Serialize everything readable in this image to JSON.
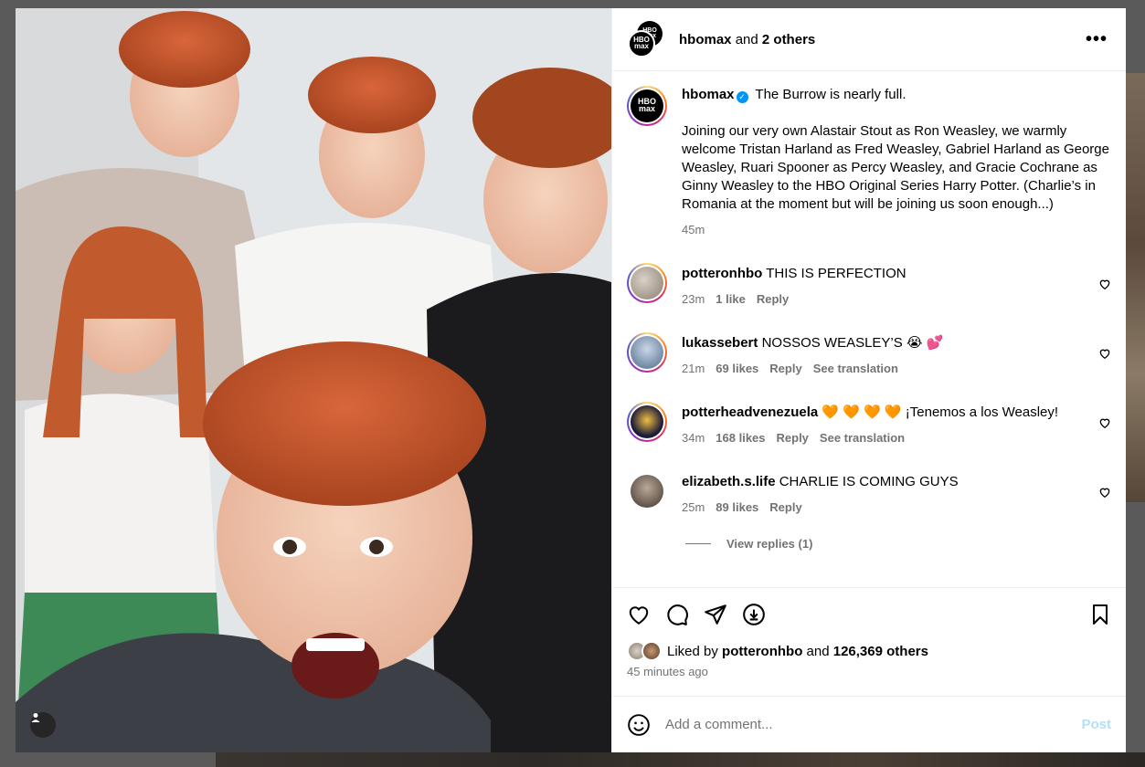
{
  "header": {
    "username": "hbomax",
    "and_text": "and",
    "others": "2 others",
    "more": "•••",
    "logo_top": "HBO",
    "logo_bottom": "max"
  },
  "caption": {
    "username": "hbomax",
    "first_line": "The Burrow is nearly full.",
    "body": "Joining our very own Alastair Stout as Ron Weasley, we warmly welcome Tristan Harland as Fred Weasley, Gabriel Harland as George Weasley, Ruari Spooner as Percy Weasley, and Gracie Cochrane as Ginny Weasley to the HBO Original Series Harry Potter. (Charlie’s in Romania at the moment but will be joining us soon enough...)",
    "time": "45m"
  },
  "comments": [
    {
      "username": "potteronhbo",
      "text": "THIS IS PERFECTION",
      "time": "23m",
      "likes": "1 like",
      "reply": "Reply",
      "translation": ""
    },
    {
      "username": "lukassebert",
      "text": "NOSSOS WEASLEY’S 😭 💕",
      "time": "21m",
      "likes": "69 likes",
      "reply": "Reply",
      "translation": "See translation"
    },
    {
      "username": "potterheadvenezuela",
      "text": "🧡 🧡 🧡 🧡 ¡Tenemos a los Weasley!",
      "time": "34m",
      "likes": "168 likes",
      "reply": "Reply",
      "translation": "See translation"
    },
    {
      "username": "elizabeth.s.life",
      "text": "CHARLIE IS COMING GUYS",
      "time": "25m",
      "likes": "89 likes",
      "reply": "Reply",
      "translation": ""
    }
  ],
  "view_replies": "View replies (1)",
  "likes": {
    "prefix": "Liked by",
    "user": "potteronhbo",
    "and": "and",
    "others": "126,369 others"
  },
  "posted": "45 minutes ago",
  "add_comment": {
    "placeholder": "Add a comment...",
    "post": "Post"
  },
  "colors": {
    "accent": "#0095f6",
    "post_disabled": "#b2dffc",
    "muted": "#737373"
  }
}
